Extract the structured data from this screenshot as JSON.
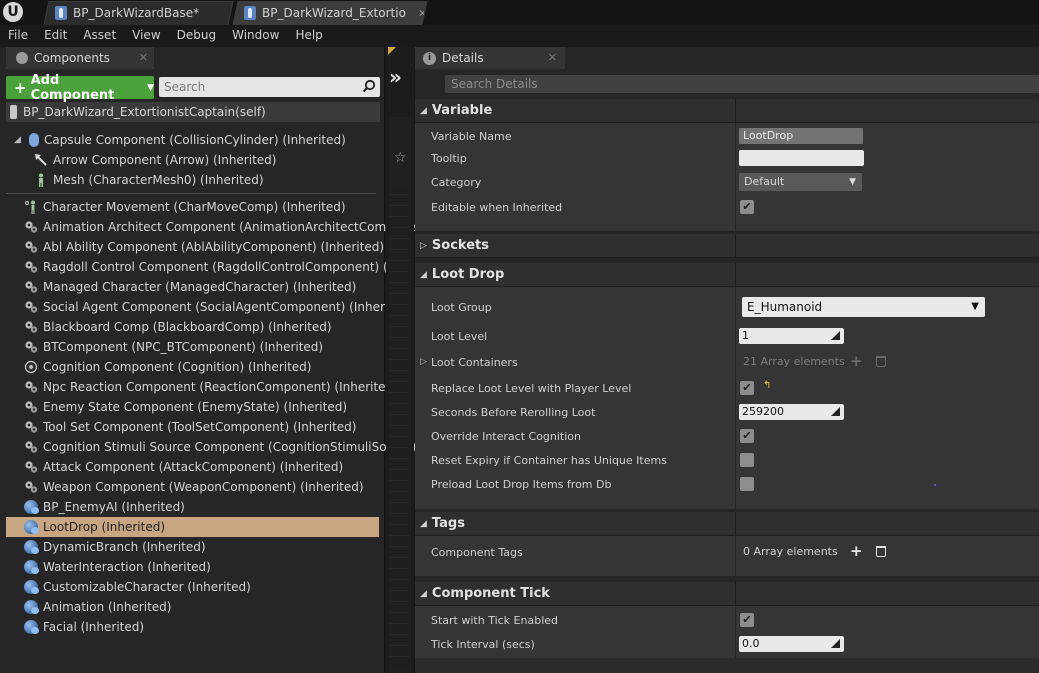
{
  "tabs": [
    {
      "label": "BP_DarkWizardBase*",
      "close": "✕"
    },
    {
      "label": "BP_DarkWizard_Extortio",
      "close": "✕"
    }
  ],
  "menu": [
    "File",
    "Edit",
    "Asset",
    "View",
    "Debug",
    "Window",
    "Help"
  ],
  "components_panel": {
    "tab_label": "Components",
    "close": "✕",
    "add_button": "Add Component",
    "search_placeholder": "Search",
    "self_label": "BP_DarkWizard_ExtortionistCaptain(self)",
    "tree": [
      {
        "label": "Capsule Component (CollisionCylinder) (Inherited)",
        "icon": "capsule-icon"
      },
      {
        "label": "Arrow Component (Arrow) (Inherited)",
        "icon": "arrow-icon"
      },
      {
        "label": "Mesh (CharacterMesh0) (Inherited)",
        "icon": "character-mesh-icon"
      }
    ],
    "components": [
      {
        "label": "Character Movement (CharMoveComp) (Inherited)",
        "icon": "movement-icon"
      },
      {
        "label": "Animation Architect Component (AnimationArchitectCompone",
        "icon": "gears-icon"
      },
      {
        "label": "Abl Ability Component (AblAbilityComponent) (Inherited)",
        "icon": "gears-icon"
      },
      {
        "label": "Ragdoll Control Component (RagdollControlComponent) (Inhe",
        "icon": "gears-icon"
      },
      {
        "label": "Managed Character (ManagedCharacter) (Inherited)",
        "icon": "gears-icon"
      },
      {
        "label": "Social Agent Component (SocialAgentComponent) (Inherited)",
        "icon": "gears-icon"
      },
      {
        "label": "Blackboard Comp (BlackboardComp) (Inherited)",
        "icon": "gears-icon"
      },
      {
        "label": "BTComponent (NPC_BTComponent) (Inherited)",
        "icon": "gears-icon"
      },
      {
        "label": "Cognition Component (Cognition) (Inherited)",
        "icon": "brain-icon"
      },
      {
        "label": "Npc Reaction Component (ReactionComponent) (Inherited)",
        "icon": "gears-icon"
      },
      {
        "label": "Enemy State Component (EnemyState) (Inherited)",
        "icon": "gears-icon"
      },
      {
        "label": "Tool Set Component (ToolSetComponent) (Inherited)",
        "icon": "gears-icon"
      },
      {
        "label": "Cognition Stimuli Source Component (CognitionStimuliSource(",
        "icon": "gears-icon"
      },
      {
        "label": "Attack Component (AttackComponent) (Inherited)",
        "icon": "gears-icon"
      },
      {
        "label": "Weapon Component (WeaponComponent) (Inherited)",
        "icon": "gears-icon"
      },
      {
        "label": "BP_EnemyAI (Inherited)",
        "icon": "blueprint-component-icon"
      },
      {
        "label": "LootDrop (Inherited)",
        "icon": "blueprint-component-icon",
        "selected": true
      },
      {
        "label": "DynamicBranch (Inherited)",
        "icon": "blueprint-component-icon"
      },
      {
        "label": "WaterInteraction (Inherited)",
        "icon": "blueprint-component-icon"
      },
      {
        "label": "CustomizableCharacter (Inherited)",
        "icon": "blueprint-component-icon"
      },
      {
        "label": "Animation (Inherited)",
        "icon": "blueprint-component-icon"
      },
      {
        "label": "Facial (Inherited)",
        "icon": "blueprint-component-icon"
      }
    ]
  },
  "details": {
    "tab_label": "Details",
    "close": "✕",
    "search_placeholder": "Search Details",
    "sections": {
      "variable": "Variable",
      "sockets": "Sockets",
      "loot_drop": "Loot Drop",
      "tags": "Tags",
      "component_tick": "Component Tick"
    },
    "variable": {
      "name_label": "Variable Name",
      "name_value": "LootDrop",
      "tooltip_label": "Tooltip",
      "category_label": "Category",
      "category_value": "Default",
      "editable_label": "Editable when Inherited"
    },
    "loot_drop": {
      "group_label": "Loot Group",
      "group_value": "E_Humanoid",
      "level_label": "Loot Level",
      "level_value": "1",
      "containers_label": "Loot Containers",
      "containers_value": "21 Array elements",
      "replace_label": "Replace Loot Level with Player Level",
      "seconds_label": "Seconds Before Rerolling Loot",
      "seconds_value": "259200",
      "override_label": "Override Interact Cognition",
      "reset_label": "Reset Expiry if Container has Unique Items",
      "preload_label": "Preload Loot Drop Items from Db"
    },
    "tags": {
      "component_tags_label": "Component Tags",
      "component_tags_value": "0 Array elements"
    },
    "component_tick": {
      "start_label": "Start with Tick Enabled",
      "interval_label": "Tick Interval (secs)",
      "interval_value": "0.0"
    }
  },
  "checkmark": "✔",
  "colors": {
    "add_button": "#4aa23a",
    "selected_row": "#c8a682",
    "reset_arrow": "#f0d040"
  }
}
